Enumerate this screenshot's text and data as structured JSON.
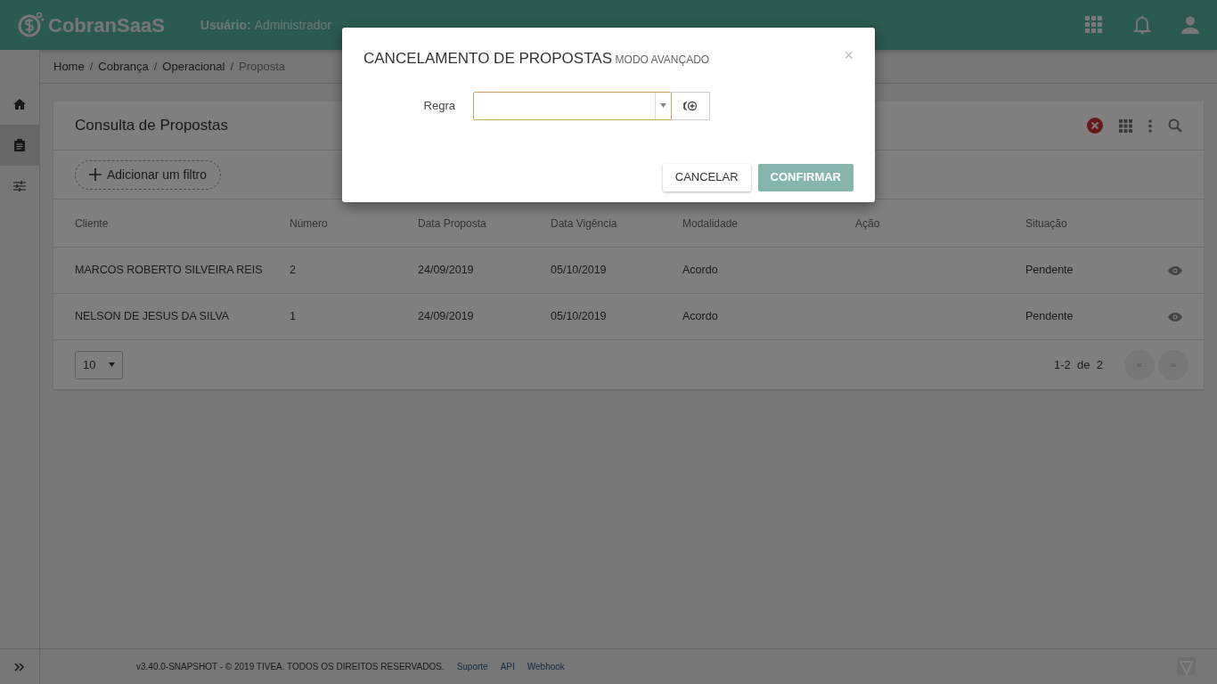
{
  "header": {
    "brand": "CobranSaaS",
    "user_label": "Usuário:",
    "user": "Administrador"
  },
  "sidebar": {
    "items": [
      {
        "kind": "home",
        "selected": false
      },
      {
        "kind": "clipboard",
        "selected": true
      },
      {
        "kind": "sliders",
        "selected": false
      }
    ]
  },
  "breadcrumb": {
    "items": [
      "Home",
      "Cobrança",
      "Operacional",
      "Proposta"
    ],
    "separator": "/"
  },
  "card": {
    "title": "Consulta de Propostas",
    "filter_button": "Adicionar um filtro",
    "columns": [
      "Cliente",
      "Número",
      "Data Proposta",
      "Data Vigência",
      "Modalidade",
      "Ação",
      "Situação"
    ],
    "rows": [
      {
        "cells": [
          "MARCOS ROBERTO SILVEIRA REIS",
          "2",
          "24/09/2019",
          "05/10/2019",
          "Acordo",
          "",
          "Pendente"
        ]
      },
      {
        "cells": [
          "NELSON DE JESUS DA SILVA",
          "1",
          "24/09/2019",
          "05/10/2019",
          "Acordo",
          "",
          "Pendente"
        ]
      }
    ],
    "page_size": "10",
    "range": "1-2  de  2",
    "prev": "«",
    "next": "»"
  },
  "footer": {
    "text": "v3.40.0-SNAPSHOT - © 2019 TIVEA. TODOS OS DIREITOS RESERVADOS.",
    "links": [
      "Suporte",
      "API",
      "Webhook"
    ]
  },
  "modal": {
    "title": "CANCELAMENTO DE PROPOSTAS",
    "subtitle": "MODO AVANÇADO",
    "close": "×",
    "field": {
      "label": "Regra",
      "focused": true
    },
    "buttons": [
      {
        "label": "CANCELAR",
        "kind": "secondary",
        "disabled": false
      },
      {
        "label": "CONFIRMAR",
        "kind": "primary",
        "disabled": true
      }
    ]
  }
}
